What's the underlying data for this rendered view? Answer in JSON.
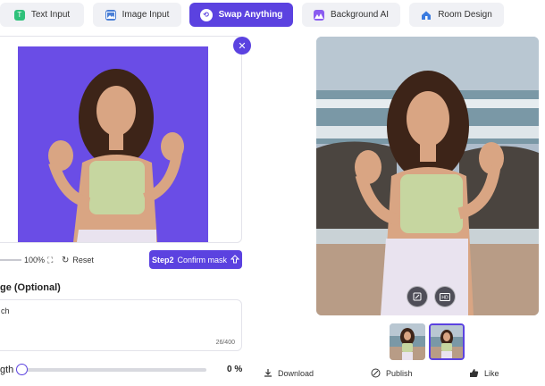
{
  "tabs": [
    {
      "label": "Text Input",
      "icon": "text-input-icon",
      "active": false
    },
    {
      "label": "Image Input",
      "icon": "image-input-icon",
      "active": false
    },
    {
      "label": "Swap Anything",
      "icon": "swap-icon",
      "active": true
    },
    {
      "label": "Background AI",
      "icon": "background-ai-icon",
      "active": false
    },
    {
      "label": "Room Design",
      "icon": "room-design-icon",
      "active": false
    }
  ],
  "editor": {
    "zoom": "100%",
    "reset_label": "Reset",
    "confirm_step": "Step2",
    "confirm_label": "Confirm mask"
  },
  "prompt": {
    "title": "ge (Optional)",
    "value": "ch",
    "count": "26/400"
  },
  "strength": {
    "label": "gth",
    "value": "0 %",
    "level": 0
  },
  "actions": {
    "download": "Download",
    "publish": "Publish",
    "like": "Like"
  },
  "colors": {
    "accent": "#5b42e0",
    "mask": "#6a4de6"
  }
}
